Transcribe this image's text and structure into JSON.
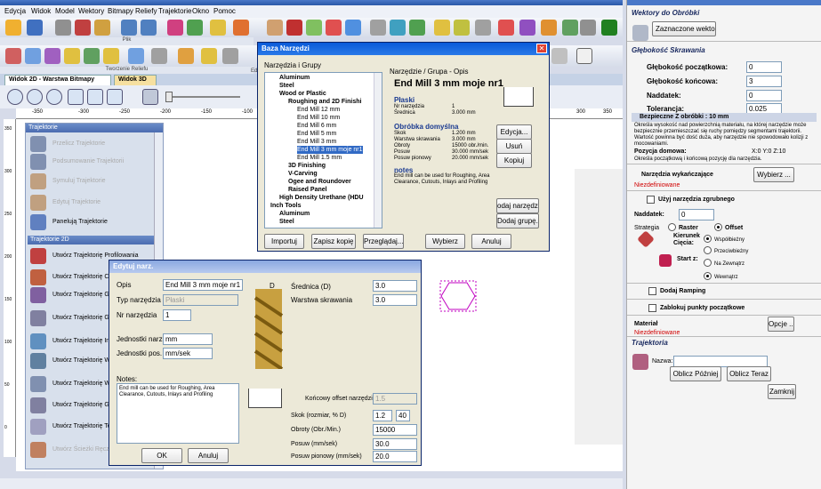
{
  "menu": [
    "Edycja",
    "Widok",
    "Model",
    "Wektory",
    "Bitmapy",
    "Reliefy",
    "Trajektorie",
    "Okno",
    "Pomoc"
  ],
  "toolbar": {
    "group1_caption": "Plik",
    "group2_caption": "Tworzenie Reliefu",
    "group3_caption": "Edy"
  },
  "tabs": [
    "Widok 2D - Warstwa Bitmapy",
    "Widok 3D"
  ],
  "ruler_ticks": [
    "-350",
    "-300",
    "-250",
    "-200",
    "-150",
    "-100",
    "300",
    "350"
  ],
  "vruler_ticks": [
    "350",
    "300",
    "250",
    "200",
    "150",
    "100",
    "50",
    "0"
  ],
  "left_panel": {
    "header": "Trajektorie",
    "items_top": [
      "Przelicz Trajektorie",
      "Podsumowanie Trajektorii",
      "Symuluj Trajektorie",
      "Edytuj Trajektorie",
      "Panelują Trajektorie"
    ],
    "section": "Trajektorie 2D",
    "items": [
      "Utwórz Trajektorię Profilowania",
      "Utwórz Trajektorię Czyszcz",
      "Utwórz Trajektorię Grawer",
      "Utwórz Trajektorię Grawer",
      "Utwórz Trajektorię Inteligen",
      "Utwórz Trajektorię Wiercen",
      "Utwórz Trajektorię Wsadu",
      "Utwórz Trajektorię Graver",
      "Utwórz Trajektorię Teks",
      "Utwórz Ścieżki Ręcznie"
    ]
  },
  "baza": {
    "title": "Baza Narzędzi",
    "tree_label": "Narzędzia i Grupy",
    "tree": [
      {
        "t": "Aluminum",
        "lvl": 1,
        "bold": true
      },
      {
        "t": "Steel",
        "lvl": 1,
        "bold": true
      },
      {
        "t": "Wood or Plastic",
        "lvl": 1,
        "bold": true
      },
      {
        "t": "Roughing and 2D Finishi",
        "lvl": 2,
        "bold": true
      },
      {
        "t": "End Mill 12 mm",
        "lvl": 3
      },
      {
        "t": "End Mill 10 mm",
        "lvl": 3
      },
      {
        "t": "End Mill 6 mm",
        "lvl": 3
      },
      {
        "t": "End Mill 5 mm",
        "lvl": 3
      },
      {
        "t": "End Mill 3 mm",
        "lvl": 3
      },
      {
        "t": "End Mill 3 mm moje nr1",
        "lvl": 3
      },
      {
        "t": "End Mill 1.5 mm",
        "lvl": 3
      },
      {
        "t": "3D Finishing",
        "lvl": 2,
        "bold": true
      },
      {
        "t": "V-Carving",
        "lvl": 2,
        "bold": true
      },
      {
        "t": "Ogee and Roundover",
        "lvl": 2,
        "bold": true
      },
      {
        "t": "Raised Panel",
        "lvl": 2,
        "bold": true
      },
      {
        "t": "High Density Urethane (HDU",
        "lvl": 1,
        "bold": true
      },
      {
        "t": "Inch Tools",
        "lvl": 0,
        "bold": true
      },
      {
        "t": "Aluminum",
        "lvl": 1,
        "bold": true
      },
      {
        "t": "Steel",
        "lvl": 1,
        "bold": true
      }
    ],
    "info_label": "Narzędzie / Grupa - Opis",
    "tool_name": "End Mill 3 mm moje nr1",
    "flat_title": "Płaski",
    "flat_rows": [
      [
        "Nr narzędzia",
        "1"
      ],
      [
        "Średnica",
        "3.000 mm"
      ]
    ],
    "proc_title": "Obróbka domyślna",
    "proc_rows": [
      [
        "Skok",
        "1.200 mm"
      ],
      [
        "Warstwa skrawania",
        "3.000 mm"
      ],
      [
        "Obroty",
        "15000 obr./min."
      ],
      [
        "Posuw",
        "30.000 mm/sek"
      ],
      [
        "Posuw pionowy",
        "20.000 mm/sek"
      ]
    ],
    "notes_title": "notes",
    "notes_text": "End mill can be used for Roughing, Area Clearance, Cutouts, Inlays and Profiling",
    "btn_edit": "Edycja...",
    "btn_del": "Usuń",
    "btn_copy": "Kopiuj",
    "btn_addtool": "odaj narzędzie",
    "btn_addgroup": "Dodaj grupę...",
    "btn_import": "Importuj",
    "btn_save": "Zapisz kopię",
    "btn_browse": "Przeglądaj...",
    "btn_select": "Wybierz",
    "btn_cancel": "Anuluj"
  },
  "edyt": {
    "title": "Edytuj narz.",
    "opis_label": "Opis",
    "opis_value": "End Mill 3 mm moje nr1",
    "typ_label": "Typ narzędzia",
    "typ_value": "Płaski",
    "nr_label": "Nr narzędzia",
    "nr_value": "1",
    "jn_label": "Jednostki narz.",
    "jn_value": "mm",
    "jp_label": "Jednostki pos.",
    "jp_value": "mm/sek",
    "notes_label": "Notes:",
    "notes_value": "End mill can be used for Roughing, Area Clearance, Cutouts, Inlays and Profiling",
    "d_label": "D",
    "sred_label": "Średnica (D)",
    "sred_value": "3.0",
    "warstwa_label": "Warstwa skrawania",
    "warstwa_value": "3.0",
    "offset_label": "Końcowy offset narzędzia",
    "offset_value": "1.5",
    "skok_label": "Skok (rozmiar, % D)",
    "skok_value": "1.2",
    "skok_pct": "40",
    "obroty_label": "Obroty (Obr./Min.)",
    "obroty_value": "15000",
    "posuw_label": "Posuw (mm/sek)",
    "posuw_value": "30.0",
    "posuwp_label": "Posuw pionowy (mm/sek)",
    "posuwp_value": "20.0",
    "btn_ok": "OK",
    "btn_cancel": "Anuluj"
  },
  "right": {
    "sec1": "Wektory do Obróbki",
    "vec_select": "Zaznaczone wektory",
    "sec2": "Głębokość Skrawania",
    "gp_label": "Głębokość początkowa:",
    "gp_value": "0",
    "gk_label": "Głębokość końcowa:",
    "gk_value": "3",
    "nad_label": "Naddatek:",
    "nad_value": "0",
    "tol_label": "Tolerancja:",
    "tol_value": "0.025",
    "bez_label": "Bezpieczne Z obróbki : 10 mm",
    "bez_desc": "Określa wysokość nad powierzchnią materiału, na której narzędzie może bezpiecznie przemieszczać się ruchy pomiędzy segmentami trajektorii. Wartość powinna być dość duża, aby narzędzie nie spowodowało kolizji z mocowaniami.",
    "poz_label": "Pozycja domowa:",
    "poz_value": "X:0 Y:0 Z:10",
    "poz_desc": "Określa początkową i końcową pozycję dla narzędzia.",
    "nw_label": "Narzędzia wykańczające",
    "nw_btn": "Wybierz ...",
    "nw_status": "Niezdefiniowane",
    "uzyj_label": "Użyj narzędzia zgrubnego",
    "nadd_label": "Naddatek:",
    "nadd_value": "0",
    "strat_label": "Strategia",
    "raster": "Raster",
    "offset": "Offset",
    "kier_label": "Kierunek Cięcia:",
    "wsp": "Współbieżny",
    "przec": "Przeciwbieżny",
    "start_label": "Start z:",
    "nazew": "Na Zewnątrz",
    "wewn": "Wewnątrz",
    "ramp_label": "Dodaj Ramping",
    "zablokuj_label": "Zablokuj punkty początkowe",
    "mat_label": "Materiał",
    "mat_btn": "Opcje ...",
    "mat_status": "Niezdefiniowane",
    "sec3": "Trajektoria",
    "nazwa_label": "Nazwa:",
    "nazwa_value": "",
    "btn_later": "Oblicz Później",
    "btn_now": "Oblicz Teraz",
    "btn_close": "Zamknij"
  }
}
